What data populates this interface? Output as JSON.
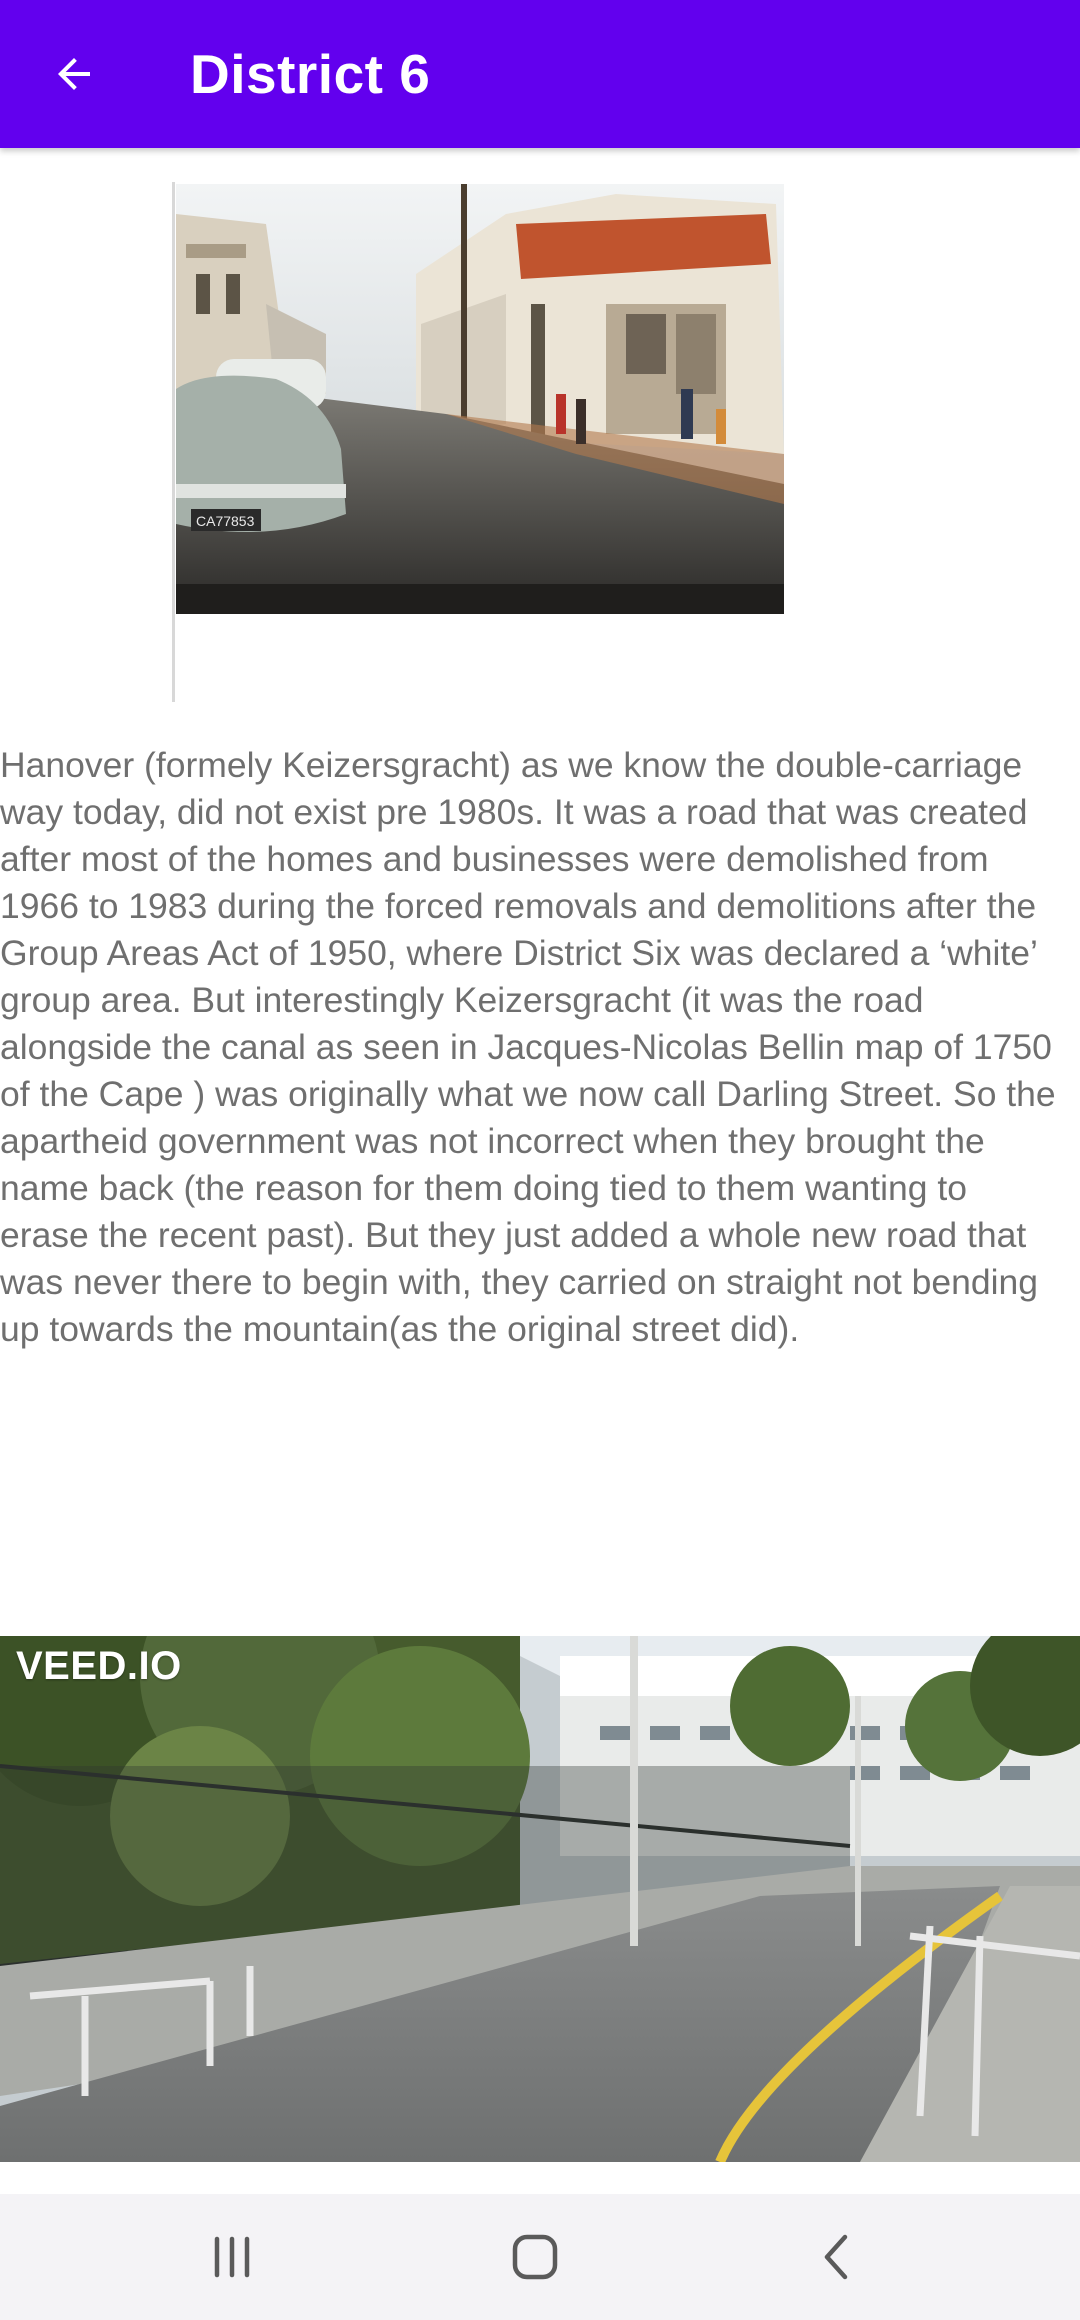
{
  "app_bar": {
    "title": "District 6",
    "back_icon": "arrow-back-icon",
    "background_color": "#6200ee"
  },
  "historic_photo": {
    "plate_text": "CA77853"
  },
  "description": "Hanover (formely Keizersgracht) as we know the double-carriage way today, did not exist pre 1980s. It was a road that was created after most of the homes and businesses were demolished from 1966 to 1983 during the forced removals and demolitions after the Group Areas Act of 1950, where District Six was declared a ‘white’ group area. But interestingly Keizersgracht (it was the road alongside the canal as seen in Jacques-Nicolas Bellin map of 1750 of the Cape ) was originally what we now call Darling Street. So the apartheid government was not incorrect when they brought the name back (the reason for them doing tied to them wanting to erase the recent past). But they just added a whole new road that was never there to begin with, they carried on straight not bending up towards the mountain(as the original street did).",
  "video": {
    "watermark": "VEED.IO"
  },
  "nav_bar": {
    "recents_icon": "recent-apps-icon",
    "home_icon": "home-icon",
    "back_icon": "back-chevron-icon"
  }
}
